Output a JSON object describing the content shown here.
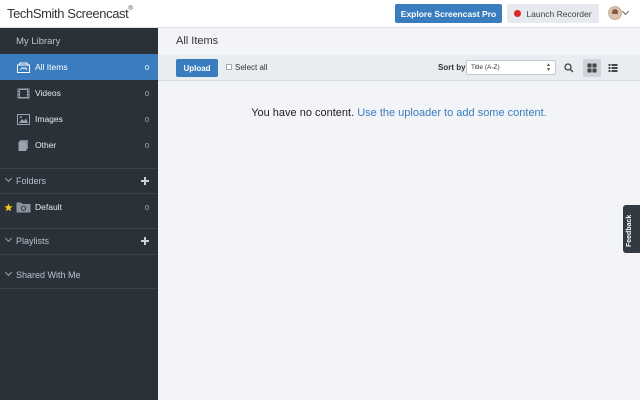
{
  "header": {
    "logo_text": "TechSmith Screencast",
    "logo_mark": "®",
    "explore_button": "Explore Screencast Pro",
    "launch_button": "Launch Recorder"
  },
  "sidebar": {
    "my_library": "My Library",
    "library_items": [
      {
        "label": "All Items",
        "count": "0",
        "icon": "all-items-icon",
        "active": true
      },
      {
        "label": "Videos",
        "count": "0",
        "icon": "film-icon"
      },
      {
        "label": "Images",
        "count": "0",
        "icon": "image-icon"
      },
      {
        "label": "Other",
        "count": "0",
        "icon": "documents-icon"
      }
    ],
    "folders_label": "Folders",
    "folders": [
      {
        "label": "Default",
        "count": "0",
        "icon": "folder-icon",
        "starred": true
      }
    ],
    "playlists_label": "Playlists",
    "shared_label": "Shared With Me"
  },
  "main": {
    "title": "All Items",
    "toolbar": {
      "upload_button": "Upload",
      "select_all_label": "Select all",
      "sort_label": "Sort by",
      "sort_value": "Title (A-Z)",
      "view_mode": "grid"
    },
    "empty_text": "You have no content.",
    "empty_link": "Use the uploader to add some content."
  },
  "feedback_tab": "Feedback",
  "colors": {
    "accent": "#3a7dbe",
    "sidebar_bg": "#2a3139",
    "record_dot": "#e02424",
    "star": "#f5c518"
  }
}
